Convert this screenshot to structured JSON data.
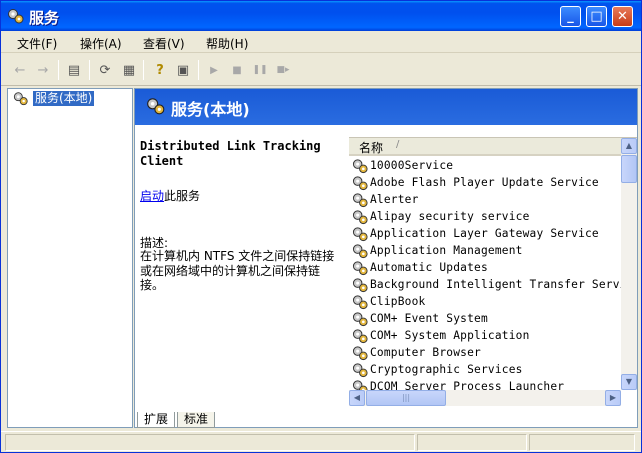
{
  "window": {
    "title": "服务",
    "minimize": "_",
    "maximize": "□",
    "close": "✕"
  },
  "menu": [
    "文件(F)",
    "操作(A)",
    "查看(V)",
    "帮助(H)"
  ],
  "toolbar": {
    "buttons": [
      {
        "icon": "back-arrow-icon",
        "glyph": "←",
        "disabled": true
      },
      {
        "icon": "forward-arrow-icon",
        "glyph": "→",
        "disabled": true
      },
      {
        "icon": "show-hide-tree-icon",
        "glyph": "▤",
        "disabled": false
      },
      {
        "icon": "refresh-icon",
        "glyph": "⟳",
        "disabled": false
      },
      {
        "icon": "export-list-icon",
        "glyph": "▦",
        "disabled": false
      },
      {
        "icon": "help-icon",
        "glyph": "?",
        "disabled": false
      },
      {
        "icon": "properties-icon",
        "glyph": "▣",
        "disabled": false
      },
      {
        "icon": "play-icon",
        "glyph": "▶",
        "disabled": true
      },
      {
        "icon": "stop-icon",
        "glyph": "■",
        "disabled": true
      },
      {
        "icon": "pause-icon",
        "glyph": "❚❚",
        "disabled": true
      },
      {
        "icon": "restart-icon",
        "glyph": "■▸",
        "disabled": true
      }
    ]
  },
  "tree": {
    "selected_label": "服务(本地)"
  },
  "pane": {
    "header_title": "服务(本地)",
    "service_name": "Distributed Link Tracking Client",
    "start_link": "启动",
    "start_suffix": "此服务",
    "description_label": "描述:",
    "description_text": "在计算机内 NTFS 文件之间保持链接或在网络域中的计算机之间保持链接。",
    "column_name": "名称",
    "sort_indicator": "/"
  },
  "services": [
    "10000Service",
    "Adobe Flash Player Update Service",
    "Alerter",
    "Alipay security service",
    "Application Layer Gateway Service",
    "Application Management",
    "Automatic Updates",
    "Background Intelligent Transfer Service",
    "ClipBook",
    "COM+ Event System",
    "COM+ System Application",
    "Computer Browser",
    "Cryptographic Services",
    "DCOM Server Process Launcher"
  ],
  "tabs": [
    "扩展",
    "标准"
  ],
  "colors": {
    "titlebar": "#0053ee",
    "selection": "#316ac5",
    "pane_header": "#1a5bd7",
    "window_bg": "#ece9d8"
  }
}
